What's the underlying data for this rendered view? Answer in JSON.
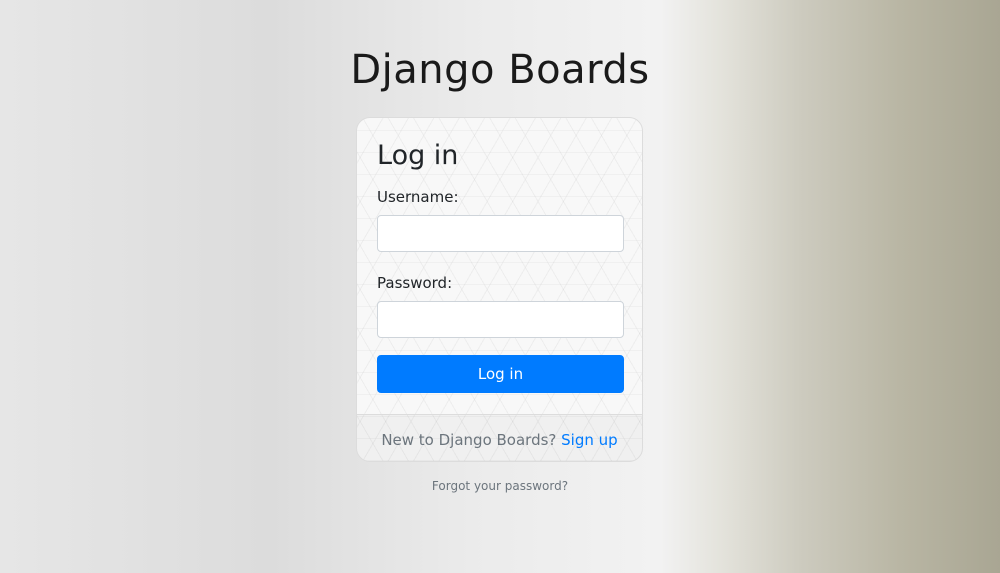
{
  "brand": {
    "title": "Django Boards"
  },
  "login_card": {
    "title": "Log in",
    "username_label": "Username:",
    "username_value": "",
    "password_label": "Password:",
    "password_value": "",
    "submit_label": "Log in"
  },
  "footer": {
    "prompt": "New to Django Boards?",
    "signup_label": "Sign up"
  },
  "forgot_password": {
    "label": "Forgot your password?"
  },
  "colors": {
    "accent": "#007bff",
    "muted_text": "#6c757d",
    "heading_text": "#212529"
  }
}
